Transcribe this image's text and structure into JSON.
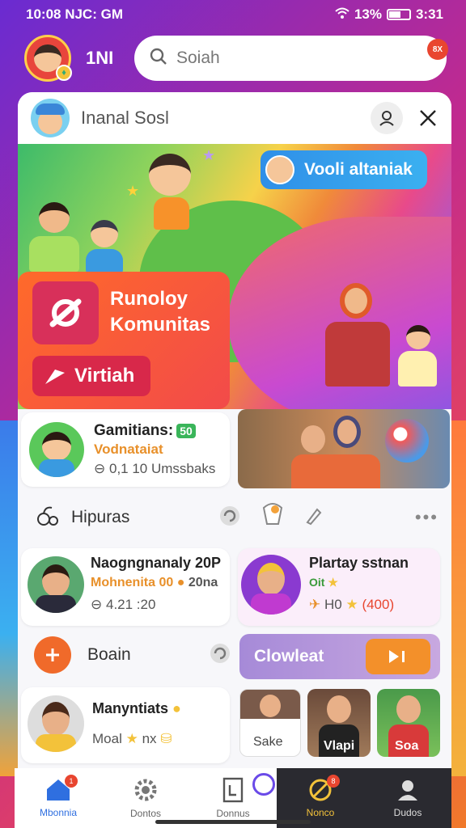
{
  "status_bar": {
    "time": "10:08 NJC: GM",
    "battery": "13%",
    "right_text": "3:31"
  },
  "top": {
    "label": "1NI",
    "search_placeholder": "Soiah",
    "notif_count": "8X"
  },
  "sheet": {
    "title": "Inanal Sosl"
  },
  "hero": {
    "pill_label": "Vooli altaniak",
    "card_title_line1": "Runoloy",
    "card_title_line2": "Komunitas",
    "button_label": "Virtiah"
  },
  "card1": {
    "title": "Gamitians:",
    "chip": "50",
    "subtitle": "Vodnataiat",
    "meta": "0,1 10 Umssbaks"
  },
  "section1": {
    "label": "Hipuras"
  },
  "card2": {
    "title": "Naogngnanaly 20P",
    "subtitle": "Mohnenita 00",
    "subtitle_extra": "20na",
    "meta": "4.21 :20"
  },
  "card3": {
    "title": "Plartay sstnan",
    "meta_left": "Oit",
    "meta": "H0",
    "meta_count": "(400)"
  },
  "section2": {
    "label": "Boain",
    "pill_label": "Clowleat"
  },
  "card4": {
    "title": "Manyntiats",
    "meta": "Moal",
    "meta_extra": "nx"
  },
  "photo_labels": {
    "first": "Sake",
    "second": "Vlapi",
    "third": "Soa"
  },
  "nav": {
    "items": [
      {
        "label": "Mbonnia",
        "icon": "home-icon"
      },
      {
        "label": "Dontos",
        "icon": "gear-icon"
      },
      {
        "label": "Donnus",
        "icon": "document-icon"
      },
      {
        "label": "Nonco",
        "icon": "blocked-icon"
      },
      {
        "label": "Dudos",
        "icon": "profile-icon"
      }
    ],
    "home_badge": "1",
    "blocked_badge": "8"
  },
  "colors": {
    "accent_orange": "#f0642a",
    "accent_blue": "#2f8fe8",
    "accent_red": "#e8452f"
  }
}
